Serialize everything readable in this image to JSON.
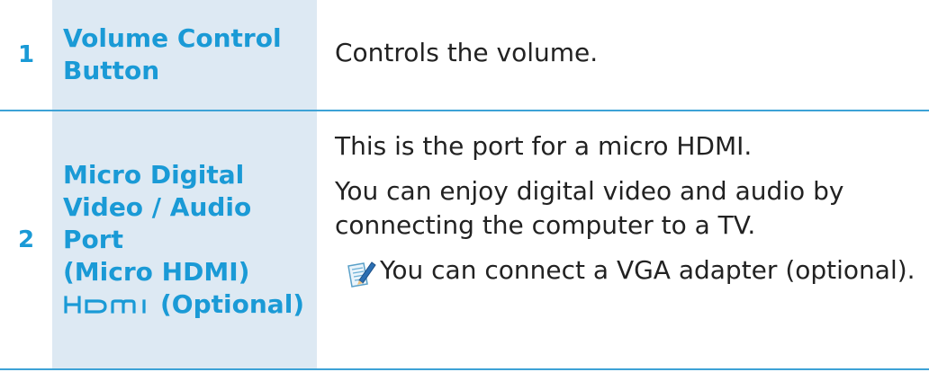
{
  "rows": [
    {
      "number": "1",
      "title_lines": [
        "Volume Control",
        "Button"
      ],
      "description": "Controls the volume."
    },
    {
      "number": "2",
      "title_lines": [
        "Micro Digital",
        "Video / Audio Port",
        "(Micro HDMI)"
      ],
      "hdmi_suffix": "(Optional)",
      "hdmi_logo_icon": "hdmi-logo",
      "paragraphs": [
        "This is the port for a micro HDMI.",
        "You can enjoy digital video and audio by connecting the computer to a TV."
      ],
      "note": "You can connect a VGA adapter (optional).",
      "note_icon": "note-pencil-icon"
    }
  ],
  "colors": {
    "accent": "#1a9ad6",
    "title_cell_bg": "#dde9f3",
    "divider": "#3da2d6",
    "body_text": "#222222"
  }
}
